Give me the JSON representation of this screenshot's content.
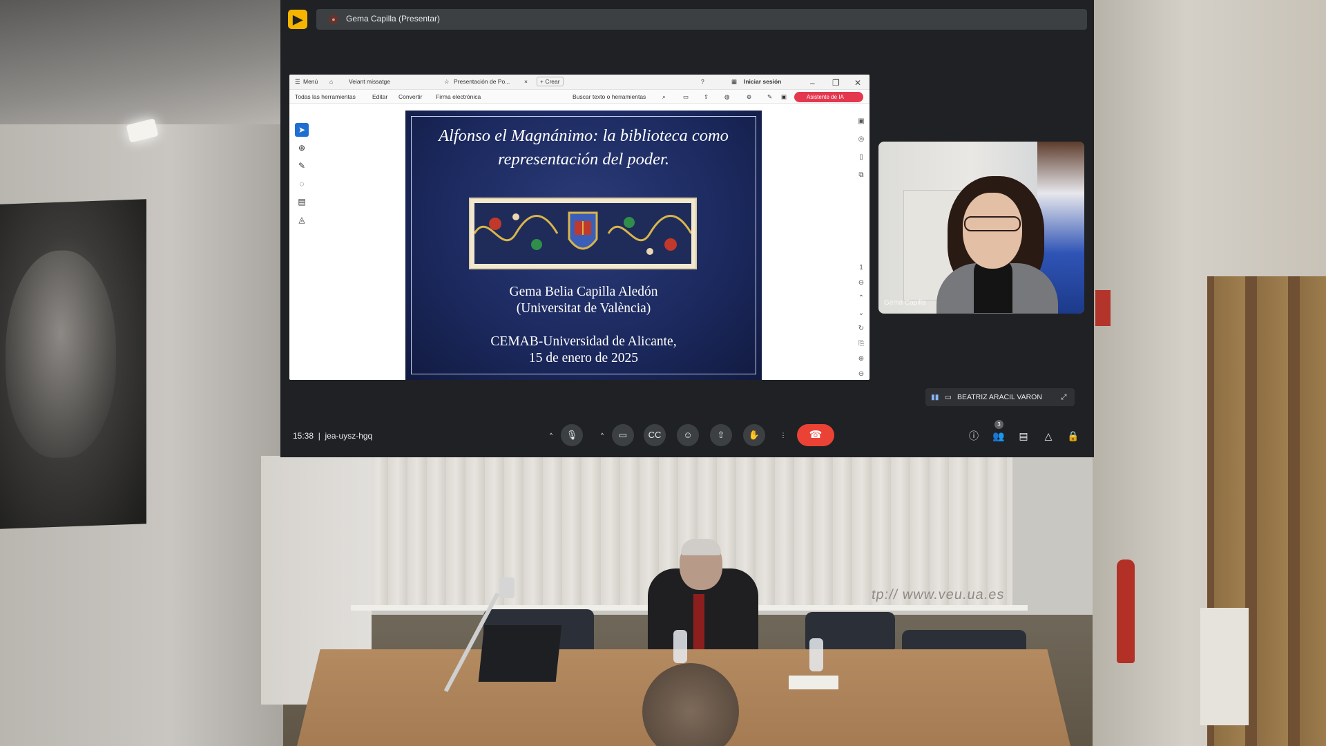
{
  "meet": {
    "presenter_label": "Gema Capilla (Presentar)",
    "meeting_time": "15:38",
    "meeting_code": "jea-uysz-hgq",
    "pinned_participant": "BEATRIZ ARACIL VARON",
    "participant_count": "3",
    "participant_tile_name": "Gema Capilla",
    "accent_end_call": "#ea4335"
  },
  "pdf_viewer": {
    "titlebar": {
      "menu": "Menú",
      "home_tab": "Veiant missatge",
      "doc_tab": "Presentación de Po...",
      "new_tab": "+ Crear",
      "sign_in": "Iniciar sesión"
    },
    "toolbar": {
      "all_tools": "Todas las herramientas",
      "edit": "Editar",
      "convert": "Convertir",
      "esign": "Firma electrónica",
      "search": "Buscar texto o herramientas",
      "ai_assistant": "Asistente de IA"
    }
  },
  "slide": {
    "title_line1": "Alfonso el Magnánimo: la biblioteca como",
    "title_line2": "representación del poder.",
    "author": "Gema Belia Capilla Aledón",
    "author_affiliation": "(Universitat de València)",
    "venue": "CEMAB-Universidad de Alicante,",
    "date": "15 de enero de 2025"
  },
  "room": {
    "watermark": "tp:// www.veu.ua.es"
  }
}
